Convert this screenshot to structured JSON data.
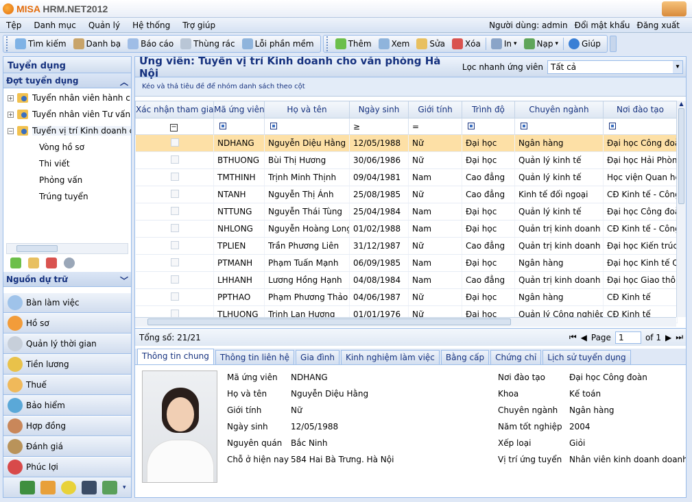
{
  "app": {
    "brand_a": "MISA ",
    "brand_b": "HRM.NET2012"
  },
  "menu": [
    "Tệp",
    "Danh mục",
    "Quản lý",
    "Hệ thống",
    "Trợ giúp"
  ],
  "user": {
    "label": "Người dùng: admin",
    "change_password": "Đổi mật khẩu",
    "logout": "Đăng xuất"
  },
  "toolbar": {
    "left": [
      "Tìm kiếm",
      "Danh bạ",
      "Báo cáo",
      "Thùng rác",
      "Lỗi phần mềm"
    ],
    "add": "Thêm",
    "view": "Xem",
    "edit": "Sửa",
    "delete": "Xóa",
    "print": "In",
    "import": "Nạp",
    "help": "Giúp"
  },
  "sidebar": {
    "title": "Tuyển dụng",
    "section": "Đợt tuyển dụng",
    "items": [
      {
        "label": "Tuyển nhân viên hành chính"
      },
      {
        "label": "Tuyển nhân viên Tư vấn"
      },
      {
        "label": "Tuyển vị trí Kinh doanh cho văn phòng Hà Nội"
      }
    ],
    "rounds": [
      "Vòng hồ sơ",
      "Thi viết",
      "Phỏng vấn",
      "Trúng tuyển"
    ],
    "reserve": "Nguồn dự trữ",
    "nav": [
      "Bàn làm việc",
      "Hồ sơ",
      "Quản lý thời gian",
      "Tiền lương",
      "Thuế",
      "Bảo hiểm",
      "Hợp đồng",
      "Đánh giá",
      "Phúc lợi"
    ]
  },
  "main": {
    "title": "Ứng viên: Tuyển vị trí Kinh doanh cho văn phòng Hà Nội",
    "quick_filter_label": "Lọc nhanh ứng viên",
    "quick_filter_value": "Tất cả",
    "group_hint": "Kéo và thả tiêu đề để nhóm danh sách theo cột",
    "columns": [
      "Xác nhận tham gia",
      "Mã ứng viên",
      "Họ và tên",
      "Ngày sinh",
      "Giới tính",
      "Trình độ",
      "Chuyên ngành",
      "Nơi đào tạo"
    ],
    "filters": [
      "",
      "",
      "",
      "≥",
      "=",
      "",
      "",
      ""
    ],
    "rows": [
      [
        "NDHANG",
        "Nguyễn Diệu Hằng",
        "12/05/1988",
        "Nữ",
        "Đại học",
        "Ngân hàng",
        "Đại học Công đoàn"
      ],
      [
        "BTHUONG",
        "Bùi Thị Hương",
        "30/06/1986",
        "Nữ",
        "Đại học",
        "Quản lý kinh tế",
        "Đại học Hải Phòng"
      ],
      [
        "TMTHINH",
        "Trịnh Minh Thịnh",
        "09/04/1981",
        "Nam",
        "Cao đẳng",
        "Quản lý kinh tế",
        "Học viện Quan hệ quốc tế"
      ],
      [
        "NTANH",
        "Nguyễn Thị Ánh",
        "25/08/1985",
        "Nữ",
        "Cao đẳng",
        "Kinh tế đối ngoại",
        "CĐ Kinh tế - Công nghiệp"
      ],
      [
        "NTTUNG",
        "Nguyễn Thái Tùng",
        "25/04/1984",
        "Nam",
        "Đại học",
        "Quản lý kinh tế",
        "Đại học Công đoàn"
      ],
      [
        "NHLONG",
        "Nguyễn Hoàng Long",
        "01/02/1988",
        "Nam",
        "Đại học",
        "Quản trị kinh doanh",
        "CĐ Kinh tế - Công nghiệp"
      ],
      [
        "TPLIEN",
        "Trần Phương Liên",
        "31/12/1987",
        "Nữ",
        "Cao đẳng",
        "Quản trị kinh doanh",
        "Đại học Kiến trúc Hà Nội"
      ],
      [
        "PTMANH",
        "Phạm Tuấn Mạnh",
        "06/09/1985",
        "Nam",
        "Đại học",
        "Ngân hàng",
        "Đại học Kinh tế Quốc dân"
      ],
      [
        "LHHANH",
        "Lương Hồng Hạnh",
        "04/08/1984",
        "Nam",
        "Cao đẳng",
        "Quản trị kinh doanh",
        "Đại học Giao thông Vận tải"
      ],
      [
        "PPTHAO",
        "Phạm Phương Thảo",
        "04/06/1987",
        "Nữ",
        "Đại học",
        "Ngân hàng",
        "CĐ Kinh tế"
      ],
      [
        "TLHUONG",
        "Trịnh Lan Hương",
        "01/01/1976",
        "Nữ",
        "Đại học",
        "Quản lý Công nghiệp",
        "CĐ Kinh tế"
      ]
    ],
    "total": "Tổng số: 21/21",
    "page_label": "Page",
    "page_value": "1",
    "page_of": "of 1"
  },
  "tabs": [
    "Thông tin chung",
    "Thông tin liên hệ",
    "Gia đình",
    "Kinh nghiệm làm việc",
    "Bằng cấp",
    "Chứng chỉ",
    "Lịch sử tuyển dụng"
  ],
  "detail": {
    "left": [
      {
        "label": "Mã ứng viên",
        "value": "NDHANG"
      },
      {
        "label": "Họ và tên",
        "value": "Nguyễn Diệu Hằng"
      },
      {
        "label": "Giới tính",
        "value": "Nữ"
      },
      {
        "label": "Ngày sinh",
        "value": "12/05/1988"
      },
      {
        "label": "Nguyên quán",
        "value": "Bắc Ninh"
      },
      {
        "label": "Chỗ ở hiện nay",
        "value": "584 Hai Bà Trưng. Hà Nội"
      }
    ],
    "right": [
      {
        "label": "Nơi đào tạo",
        "value": "Đại học Công đoàn"
      },
      {
        "label": "Khoa",
        "value": "Kế toán"
      },
      {
        "label": "Chuyên ngành",
        "value": "Ngân hàng"
      },
      {
        "label": "Năm tốt nghiệp",
        "value": "2004"
      },
      {
        "label": "Xếp loại",
        "value": "Giỏi"
      },
      {
        "label": "Vị trí ứng tuyển",
        "value": "Nhân viên kinh doanh doanh nghiệp"
      }
    ]
  }
}
